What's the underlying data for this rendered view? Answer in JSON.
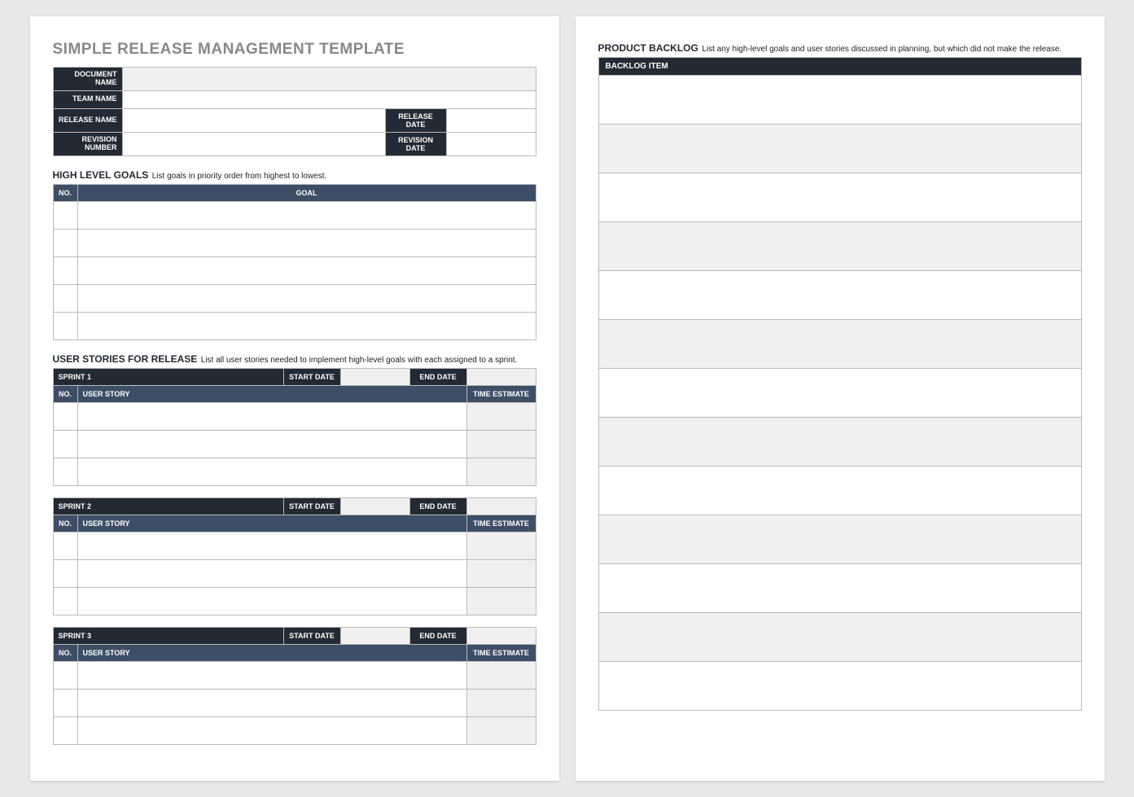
{
  "page1": {
    "title": "SIMPLE RELEASE MANAGEMENT TEMPLATE",
    "info": {
      "doc_name_label": "DOCUMENT NAME",
      "team_name_label": "TEAM NAME",
      "release_name_label": "RELEASE NAME",
      "release_date_label": "RELEASE DATE",
      "revision_number_label": "REVISION NUMBER",
      "revision_date_label": "REVISION DATE"
    },
    "goals": {
      "heading": "HIGH LEVEL GOALS",
      "desc": "List goals in priority order from highest to lowest.",
      "cols": {
        "no": "NO.",
        "goal": "GOAL"
      }
    },
    "stories": {
      "heading": "USER STORIES FOR RELEASE",
      "desc": "List all user stories needed to implement high-level goals with each assigned to a sprint.",
      "start_date_label": "START DATE",
      "end_date_label": "END DATE",
      "cols": {
        "no": "NO.",
        "story": "USER STORY",
        "estimate": "TIME ESTIMATE"
      },
      "sprints": [
        {
          "name": "SPRINT 1"
        },
        {
          "name": "SPRINT 2"
        },
        {
          "name": "SPRINT 3"
        }
      ]
    }
  },
  "page2": {
    "heading": "PRODUCT BACKLOG",
    "desc": "List any high-level goals and user stories discussed in planning, but which did not make the release.",
    "col_header": "BACKLOG ITEM"
  }
}
